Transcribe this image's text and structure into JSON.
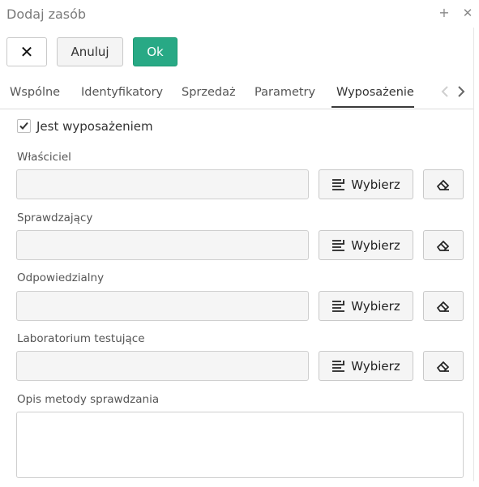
{
  "window": {
    "title": "Dodaj zasób",
    "add_icon": "+",
    "close_icon": "✕"
  },
  "toolbar": {
    "close_glyph": "✕",
    "cancel_label": "Anuluj",
    "ok_label": "Ok",
    "ok_color": "#28a985"
  },
  "tabs": [
    {
      "label": "Wspólne"
    },
    {
      "label": "Identyfikatory"
    },
    {
      "label": "Sprzedaż"
    },
    {
      "label": "Parametry"
    },
    {
      "label": "Wyposażenie",
      "active": true
    }
  ],
  "tab_nav": {
    "prev_icon": "chevron-left-icon",
    "next_icon": "chevron-right-icon"
  },
  "equipment": {
    "checkbox_label": "Jest wyposażeniem",
    "checked": true
  },
  "fields": [
    {
      "label": "Właściciel",
      "value": "",
      "select_label": "Wybierz"
    },
    {
      "label": "Sprawdzający",
      "value": "",
      "select_label": "Wybierz"
    },
    {
      "label": "Odpowiedzialny",
      "value": "",
      "select_label": "Wybierz"
    },
    {
      "label": "Laboratorium testujące",
      "value": "",
      "select_label": "Wybierz"
    }
  ],
  "description": {
    "label": "Opis metody sprawdzania",
    "value": ""
  }
}
